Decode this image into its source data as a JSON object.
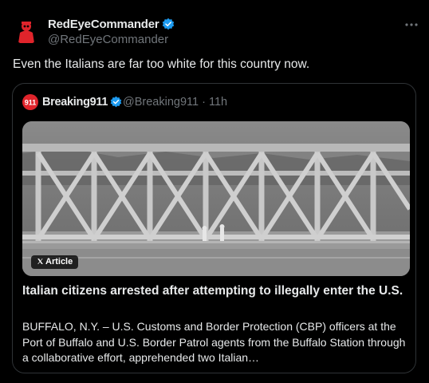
{
  "post": {
    "author_name": "RedEyeCommander",
    "author_handle": "@RedEyeCommander",
    "text": "Even the Italians are far too white for this country now."
  },
  "quoted": {
    "author_name": "Breaking911",
    "author_handle": "@Breaking911",
    "separator": "·",
    "time": "11h",
    "avatar_text": "911",
    "badge_label": "Article",
    "headline": "Italian citizens arrested after attempting to illegally enter the U.S.",
    "description": "BUFFALO, N.Y. – U.S. Customs and Border Protection (CBP) officers at the Port of Buffalo and U.S. Border Patrol agents from the Buffalo Station through a collaborative effort, apprehended two Italian…"
  },
  "colors": {
    "background": "#000000",
    "text_primary": "#e7e9ea",
    "text_secondary": "#71767b",
    "border": "#2f3336",
    "verified": "#1d9bf0",
    "avatar_red": "#e0242b"
  },
  "icons": [
    "verified-icon",
    "more-icon",
    "x-logo-icon"
  ]
}
